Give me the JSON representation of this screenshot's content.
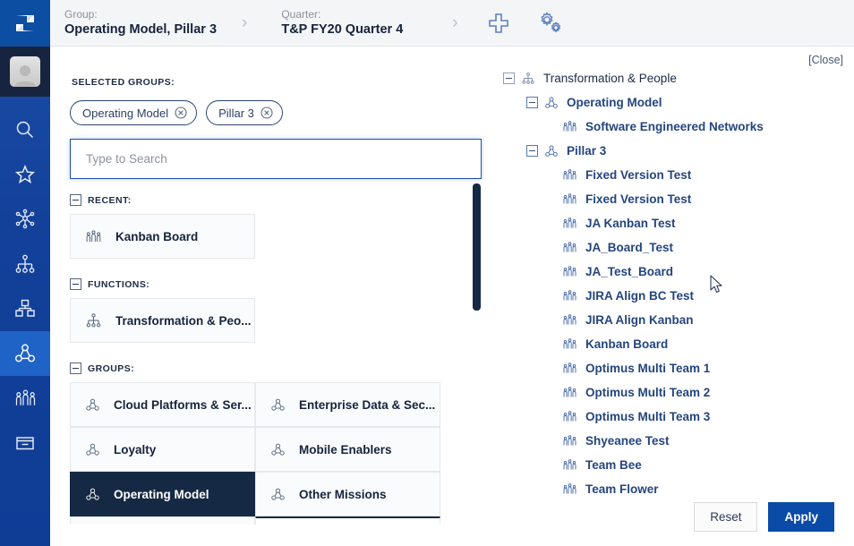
{
  "brand": {
    "primary": "#0a4ba8",
    "dark_navy": "#152944",
    "rail_blue": "#13419a",
    "link_blue": "#24457f"
  },
  "rail": {
    "logo_name": "jira-align-logo-icon",
    "avatar_name": "user-avatar",
    "items": [
      {
        "name": "search-icon",
        "label": "Search"
      },
      {
        "name": "star-icon",
        "label": "Favorites"
      },
      {
        "name": "network-nodes-icon",
        "label": "Network"
      },
      {
        "name": "org-hierarchy-icon",
        "label": "Hierarchy"
      },
      {
        "name": "portfolio-boxes-icon",
        "label": "Portfolio"
      },
      {
        "name": "group-people-icon",
        "label": "Groups"
      },
      {
        "name": "teams-people-icon",
        "label": "Teams"
      },
      {
        "name": "archive-box-icon",
        "label": "Archive"
      }
    ],
    "active_index": 5
  },
  "topbar": {
    "group": {
      "label": "Group:",
      "value": "Operating Model, Pillar 3"
    },
    "quarter": {
      "label": "Quarter:",
      "value": "T&P FY20 Quarter 4"
    },
    "separator": "›",
    "add_button": "add-plus-icon",
    "settings_button": "settings-gears-icon"
  },
  "left": {
    "selected_groups_label": "SELECTED GROUPS:",
    "chips": [
      {
        "label": "Operating Model",
        "remove_icon": "remove-circle-icon"
      },
      {
        "label": "Pillar 3",
        "remove_icon": "remove-circle-icon"
      }
    ],
    "search": {
      "placeholder": "Type to Search",
      "value": ""
    },
    "sections": [
      {
        "title": "RECENT:",
        "items": [
          {
            "label": "Kanban Board",
            "icon": "teams-people-icon",
            "selected": false
          }
        ]
      },
      {
        "title": "FUNCTIONS:",
        "items": [
          {
            "label": "Transformation & Peo...",
            "icon": "org-hierarchy-icon",
            "selected": false
          }
        ]
      },
      {
        "title": "GROUPS:",
        "items": [
          {
            "label": "Cloud Platforms & Ser...",
            "icon": "group-people-icon",
            "selected": false
          },
          {
            "label": "Enterprise Data & Sec...",
            "icon": "group-people-icon",
            "selected": false
          },
          {
            "label": "Loyalty",
            "icon": "group-people-icon",
            "selected": false
          },
          {
            "label": "Mobile Enablers",
            "icon": "group-people-icon",
            "selected": false
          },
          {
            "label": "Operating Model",
            "icon": "group-people-icon",
            "selected": true
          },
          {
            "label": "Other Missions",
            "icon": "group-people-icon",
            "selected": false
          }
        ]
      }
    ]
  },
  "right": {
    "close_label": "[Close]",
    "tree": [
      {
        "label": "Transformation & People",
        "level": 0,
        "icon": "org-hierarchy-icon",
        "toggle": "minus",
        "bold": false
      },
      {
        "label": "Operating Model",
        "level": 1,
        "icon": "group-people-icon",
        "toggle": "minus",
        "bold": true
      },
      {
        "label": "Software Engineered Networks",
        "level": 2,
        "icon": "teams-people-icon",
        "toggle": "none",
        "bold": true
      },
      {
        "label": "Pillar 3",
        "level": 1,
        "icon": "group-people-icon",
        "toggle": "minus",
        "bold": true
      },
      {
        "label": "Fixed Version Test",
        "level": 2,
        "icon": "teams-people-icon",
        "toggle": "none",
        "bold": true
      },
      {
        "label": "Fixed Version Test",
        "level": 2,
        "icon": "teams-people-icon",
        "toggle": "none",
        "bold": true
      },
      {
        "label": "JA Kanban Test",
        "level": 2,
        "icon": "teams-people-icon",
        "toggle": "none",
        "bold": true
      },
      {
        "label": "JA_Board_Test",
        "level": 2,
        "icon": "teams-people-icon",
        "toggle": "none",
        "bold": true
      },
      {
        "label": "JA_Test_Board",
        "level": 2,
        "icon": "teams-people-icon",
        "toggle": "none",
        "bold": true
      },
      {
        "label": "JIRA Align BC Test",
        "level": 2,
        "icon": "teams-people-icon",
        "toggle": "none",
        "bold": true
      },
      {
        "label": "JIRA Align Kanban",
        "level": 2,
        "icon": "teams-people-icon",
        "toggle": "none",
        "bold": true
      },
      {
        "label": "Kanban Board",
        "level": 2,
        "icon": "teams-people-icon",
        "toggle": "none",
        "bold": true
      },
      {
        "label": "Optimus Multi Team 1",
        "level": 2,
        "icon": "teams-people-icon",
        "toggle": "none",
        "bold": true
      },
      {
        "label": "Optimus Multi Team 2",
        "level": 2,
        "icon": "teams-people-icon",
        "toggle": "none",
        "bold": true
      },
      {
        "label": "Optimus Multi Team 3",
        "level": 2,
        "icon": "teams-people-icon",
        "toggle": "none",
        "bold": true
      },
      {
        "label": "Shyeanee Test",
        "level": 2,
        "icon": "teams-people-icon",
        "toggle": "none",
        "bold": true
      },
      {
        "label": "Team Bee",
        "level": 2,
        "icon": "teams-people-icon",
        "toggle": "none",
        "bold": true
      },
      {
        "label": "Team Flower",
        "level": 2,
        "icon": "teams-people-icon",
        "toggle": "none",
        "bold": true
      }
    ],
    "reset_label": "Reset",
    "apply_label": "Apply"
  }
}
